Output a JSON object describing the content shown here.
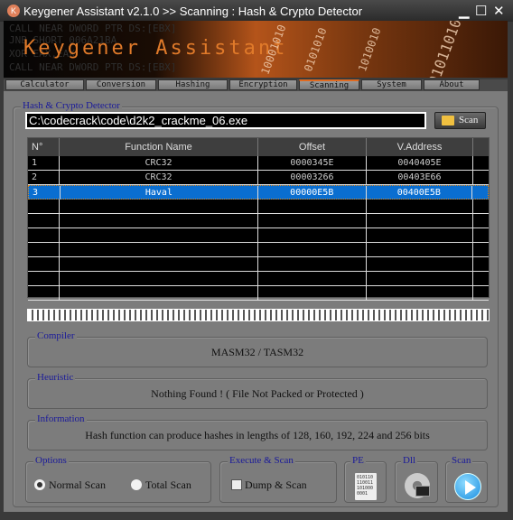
{
  "window": {
    "title": "Keygener Assistant v2.1.0  >>  Scanning : Hash & Crypto Detector",
    "minimize": "▁",
    "maximize": "☐",
    "close": "✕",
    "icon_letter": "K"
  },
  "banner": {
    "brand": "Keygener Assistant",
    "asm_lines": [
      "CALL    NEAR DWORD PTR DS:[EBX]",
      "JNB     SHORT 006A21BA",
      "XOR     EAX,EAX",
      "CALL    NEAR DWORD PTR DS:[EBX]"
    ]
  },
  "tabs": [
    {
      "label": "Calculator"
    },
    {
      "label": "Conversion"
    },
    {
      "label": "Hashing"
    },
    {
      "label": "Encryption"
    },
    {
      "label": "Scanning",
      "active": true
    },
    {
      "label": "System"
    },
    {
      "label": "About"
    }
  ],
  "detector": {
    "group_label": "Hash & Crypto Detector",
    "path_value": "C:\\codecrack\\code\\d2k2_crackme_06.exe",
    "scan_label": "Scan",
    "columns": [
      "N°",
      "Function Name",
      "Offset",
      "V.Address"
    ],
    "rows": [
      {
        "n": "1",
        "name": "CRC32",
        "offset": "0000345E",
        "vaddr": "0040405E"
      },
      {
        "n": "2",
        "name": "CRC32",
        "offset": "00003266",
        "vaddr": "00403E66"
      },
      {
        "n": "3",
        "name": "Haval",
        "offset": "00000E5B",
        "vaddr": "00400E5B",
        "selected": true
      }
    ],
    "progress": 1.0
  },
  "compiler": {
    "label": "Compiler",
    "value": "MASM32 / TASM32"
  },
  "heuristic": {
    "label": "Heuristic",
    "value": "Nothing Found ! ( File Not Packed or Protected )"
  },
  "information": {
    "label": "Information",
    "value": "Hash function can produce hashes in lengths of 128, 160, 192, 224 and 256 bits"
  },
  "options": {
    "label": "Options",
    "normal": "Normal Scan",
    "total": "Total Scan",
    "selected": "Normal Scan"
  },
  "execute": {
    "label": "Execute & Scan",
    "dump": "Dump & Scan",
    "dump_checked": false
  },
  "pe": {
    "label": "PE",
    "icon_text": "010110 110011 101000 0001"
  },
  "dll": {
    "label": "Dll"
  },
  "scan2": {
    "label": "Scan"
  },
  "colors": {
    "accent": "#e06a20",
    "selection": "#0a6ed0",
    "group_label": "#1a1a9a"
  }
}
